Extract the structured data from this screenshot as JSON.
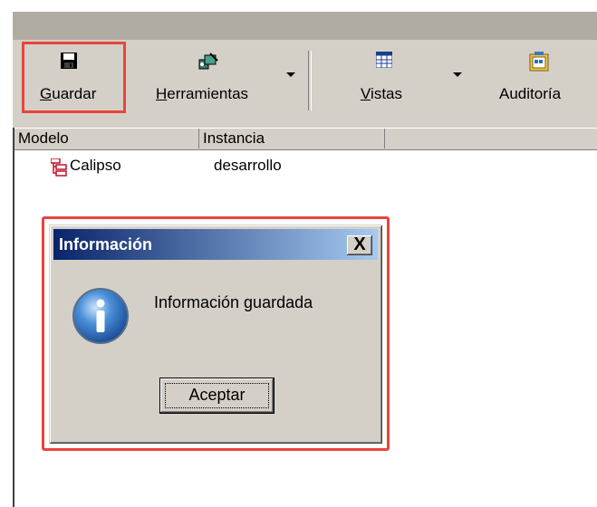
{
  "toolbar": {
    "save_label": "Guardar",
    "save_mnemonic": "G",
    "save_rest": "uardar",
    "tools_mnemonic": "H",
    "tools_rest": "erramientas",
    "views_mnemonic": "V",
    "views_rest": "istas",
    "audit_label": "Auditoría"
  },
  "list": {
    "columns": [
      "Modelo",
      "Instancia",
      ""
    ],
    "rows": [
      {
        "model": "Calipso",
        "instance": "desarrollo"
      }
    ]
  },
  "dialog": {
    "title": "Información",
    "close_glyph": "X",
    "message": "Información guardada",
    "ok_label": "Aceptar"
  },
  "colors": {
    "highlight": "#e8453c",
    "title_bar_start": "#0a246a",
    "title_bar_end": "#a6caf0",
    "face": "#d4d0c8"
  },
  "icons": [
    "floppy-disk-icon",
    "tools-icon",
    "views-grid-icon",
    "audit-icon",
    "model-tree-icon",
    "info-icon",
    "close-icon"
  ]
}
